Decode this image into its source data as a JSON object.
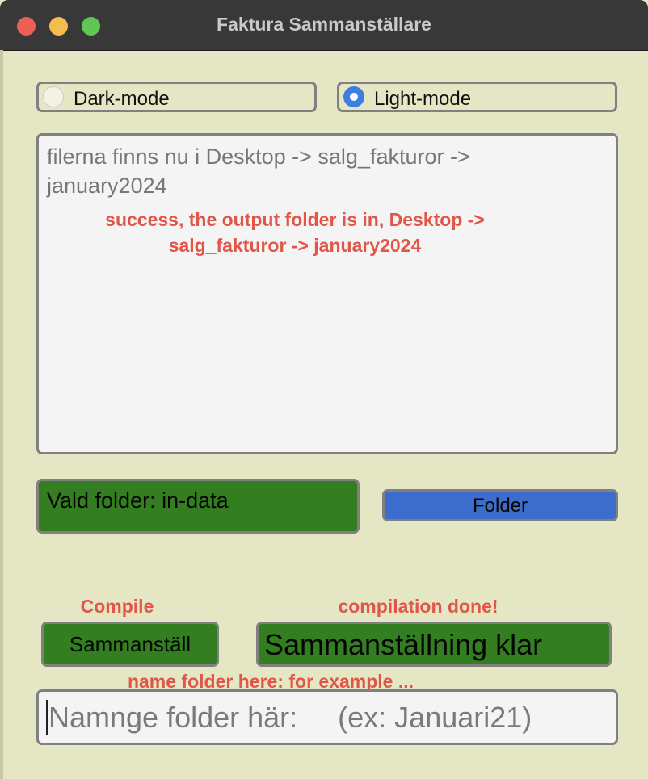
{
  "window": {
    "title": "Faktura Sammanställare"
  },
  "theme": {
    "dark_label": "Dark-mode",
    "light_label": "Light-mode",
    "selected": "Light-mode",
    "accent_color": "#3d7fe0",
    "button_green": "#327e21",
    "button_blue": "#3c6dcc",
    "annotation_color": "#e0574a"
  },
  "output": {
    "text": "filerna finns nu i Desktop -> salg_fakturor -> january2024"
  },
  "folder": {
    "status": "Vald folder: in-data",
    "button_label": "Folder"
  },
  "compile": {
    "button_label": "Sammanställ",
    "status": "Sammanställning klar"
  },
  "name_input": {
    "placeholder": "Namnge folder här:     (ex: Januari21)",
    "value": ""
  },
  "annotations": {
    "success": "success, the output folder is in, Desktop -> salg_fakturor -> january2024",
    "compile": "Compile",
    "done": "compilation done!",
    "name_hint": "name folder here: for example ..."
  }
}
